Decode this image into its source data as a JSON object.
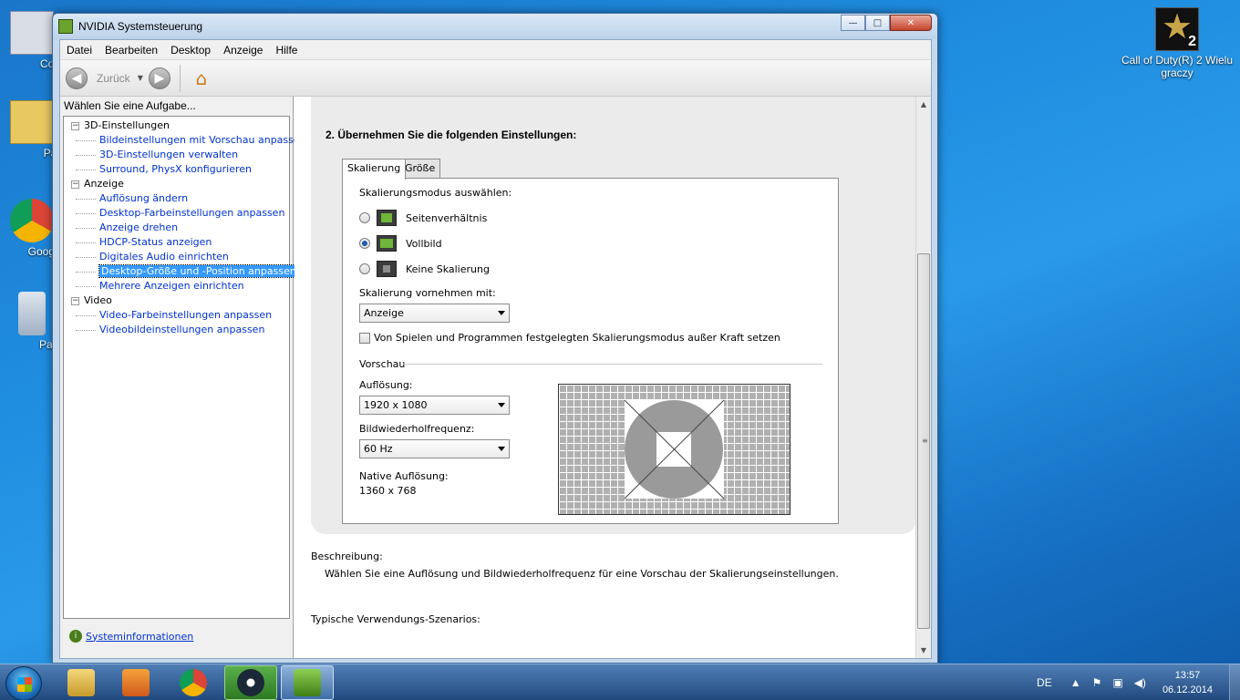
{
  "desktop": {
    "icons_left": [
      "Con",
      "Pa",
      "Google",
      "Papi"
    ],
    "cod_icon_label": "Call of Duty(R) 2 Wielu graczy",
    "cod_badge": "2"
  },
  "window": {
    "title": "NVIDIA Systemsteuerung",
    "controls": {
      "minimize": "—",
      "maximize": "□",
      "close": "✕"
    }
  },
  "menu": [
    "Datei",
    "Bearbeiten",
    "Desktop",
    "Anzeige",
    "Hilfe"
  ],
  "toolbar": {
    "back_label": "Zurück"
  },
  "left": {
    "heading": "Wählen Sie eine Aufgabe...",
    "groups": [
      {
        "label": "3D-Einstellungen",
        "items": [
          "Bildeinstellungen mit Vorschau anpassen",
          "3D-Einstellungen verwalten",
          "Surround, PhysX konfigurieren"
        ]
      },
      {
        "label": "Anzeige",
        "items": [
          "Auflösung ändern",
          "Desktop-Farbeinstellungen anpassen",
          "Anzeige drehen",
          "HDCP-Status anzeigen",
          "Digitales Audio einrichten",
          "Desktop-Größe und -Position anpassen",
          "Mehrere Anzeigen einrichten"
        ]
      },
      {
        "label": "Video",
        "items": [
          "Video-Farbeinstellungen anpassen",
          "Videobildeinstellungen anpassen"
        ]
      }
    ],
    "selected_item": "Desktop-Größe und -Position anpassen",
    "system_info": "Systeminformationen"
  },
  "main": {
    "step_title": "2. Übernehmen Sie die folgenden Einstellungen:",
    "tabs": [
      "Skalierung",
      "Größe"
    ],
    "active_tab": "Skalierung",
    "mode_label": "Skalierungsmodus auswählen:",
    "modes": [
      {
        "label": "Seitenverhältnis",
        "selected": false
      },
      {
        "label": "Vollbild",
        "selected": true
      },
      {
        "label": "Keine Skalierung",
        "selected": false
      }
    ],
    "perform_label": "Skalierung vornehmen mit:",
    "perform_value": "Anzeige",
    "override_label": "Von Spielen und Programmen festgelegten Skalierungsmodus außer Kraft setzen",
    "override_checked": false,
    "preview_label": "Vorschau",
    "resolution_label": "Auflösung:",
    "resolution_value": "1920 x 1080",
    "refresh_label": "Bildwiederholfrequenz:",
    "refresh_value": "60 Hz",
    "native_label": "Native Auflösung:",
    "native_value": "1360 x 768",
    "description_label": "Beschreibung:",
    "description_text": "Wählen Sie eine Auflösung und Bildwiederholfrequenz für eine Vorschau der Skalierungseinstellungen.",
    "usage_label": "Typische Verwendungs-Szenarios:"
  },
  "taskbar": {
    "language": "DE",
    "time": "13:57",
    "date": "06.12.2014"
  },
  "colors": {
    "selection": "#3399ff",
    "link": "#0033cc",
    "nvidia_green": "#6fb63a"
  }
}
